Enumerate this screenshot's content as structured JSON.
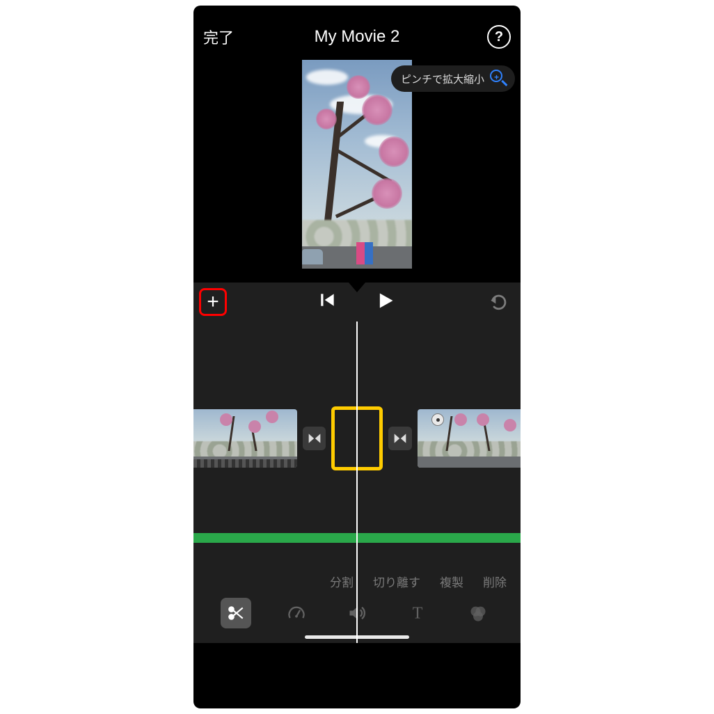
{
  "header": {
    "done_label": "完了",
    "title": "My Movie 2",
    "help_label": "?"
  },
  "preview": {
    "pinch_tip": "ピンチで拡大縮小"
  },
  "controls": {
    "add_label": "+"
  },
  "clip_actions": {
    "split": "分割",
    "detach": "切り離す",
    "duplicate": "複製",
    "delete": "削除"
  },
  "tools": {
    "cut": "cut",
    "speed": "speed",
    "volume": "volume",
    "text": "text",
    "filter": "filter"
  }
}
